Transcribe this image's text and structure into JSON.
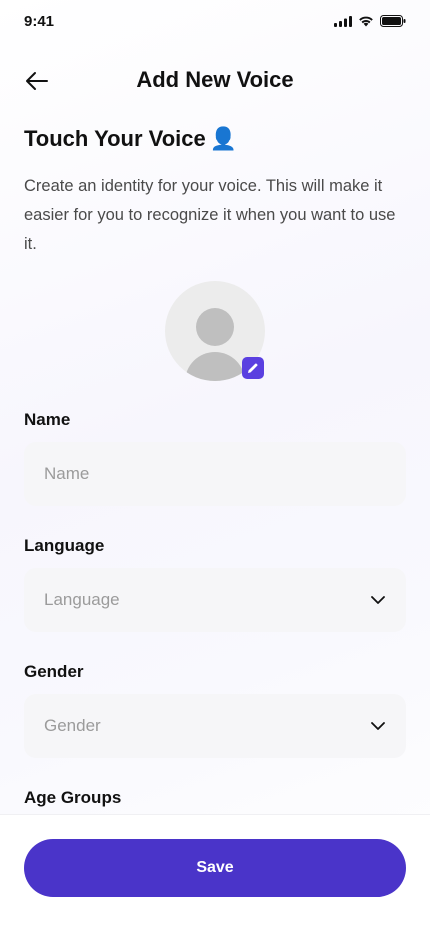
{
  "status_bar": {
    "time": "9:41"
  },
  "header": {
    "title": "Add New Voice"
  },
  "intro": {
    "title": "Touch Your Voice",
    "emoji": "👤",
    "description": "Create an identity for your voice. This will make it easier for you to recognize it when you want to use it."
  },
  "form": {
    "name": {
      "label": "Name",
      "placeholder": "Name",
      "value": ""
    },
    "language": {
      "label": "Language",
      "placeholder": "Language"
    },
    "gender": {
      "label": "Gender",
      "placeholder": "Gender"
    },
    "age_groups": {
      "label": "Age Groups"
    }
  },
  "actions": {
    "save_label": "Save"
  },
  "colors": {
    "accent": "#4a34c9",
    "edit_badge": "#5a3fe0",
    "field_bg": "#f6f6f8"
  }
}
